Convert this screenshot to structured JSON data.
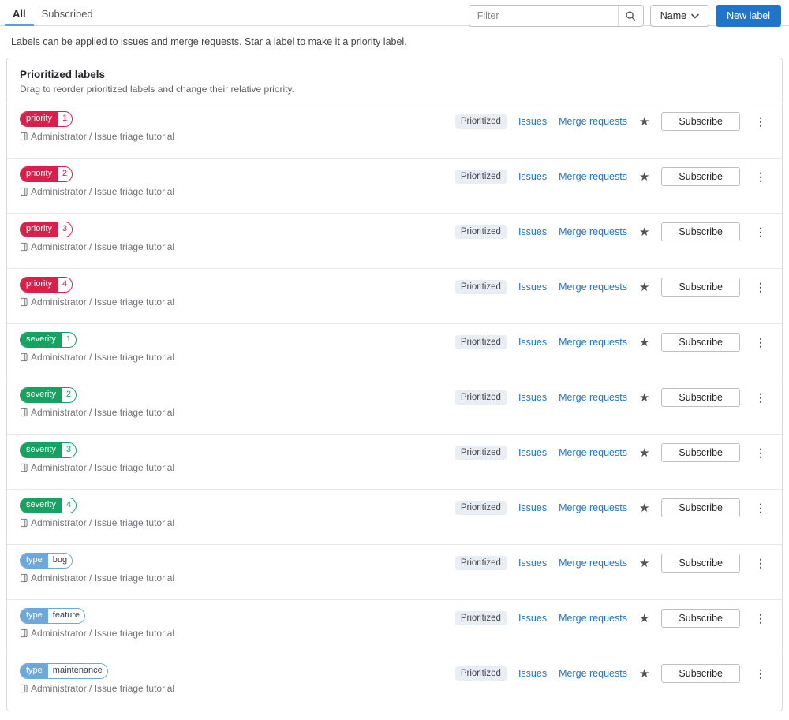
{
  "tabs": [
    {
      "label": "All",
      "active": true
    },
    {
      "label": "Subscribed",
      "active": false
    }
  ],
  "toolbar": {
    "filter_placeholder": "Filter",
    "sort_button_label": "Name",
    "new_label_button": "New label"
  },
  "description": "Labels can be applied to issues and merge requests. Star a label to make it a priority label.",
  "card": {
    "title": "Prioritized labels",
    "subtitle": "Drag to reorder prioritized labels and change their relative priority."
  },
  "row_actions": {
    "prioritized_badge": "Prioritized",
    "issues": "Issues",
    "merge_requests": "Merge requests",
    "subscribe": "Subscribe",
    "star_icon": "★",
    "kebab_icon": "⋮"
  },
  "colors": {
    "accent_blue": "#1f75cb",
    "tab_underline": "#5e9ce0",
    "priority_red": "#dc1e4a",
    "severity_green": "#16a362",
    "type_blue": "#6ba9dd",
    "type_value_text": "#3a3a3f",
    "prioritized_badge_bg": "#e9eef5",
    "card_border": "#dbdbdf"
  },
  "labels": [
    {
      "scope": "priority",
      "value": "1",
      "color": "#dc1e4a",
      "value_color": "#dc1e4a",
      "project": "Administrator / Issue triage tutorial"
    },
    {
      "scope": "priority",
      "value": "2",
      "color": "#dc1e4a",
      "value_color": "#dc1e4a",
      "project": "Administrator / Issue triage tutorial"
    },
    {
      "scope": "priority",
      "value": "3",
      "color": "#dc1e4a",
      "value_color": "#dc1e4a",
      "project": "Administrator / Issue triage tutorial"
    },
    {
      "scope": "priority",
      "value": "4",
      "color": "#dc1e4a",
      "value_color": "#dc1e4a",
      "project": "Administrator / Issue triage tutorial"
    },
    {
      "scope": "severity",
      "value": "1",
      "color": "#16a362",
      "value_color": "#16a362",
      "project": "Administrator / Issue triage tutorial"
    },
    {
      "scope": "severity",
      "value": "2",
      "color": "#16a362",
      "value_color": "#16a362",
      "project": "Administrator / Issue triage tutorial"
    },
    {
      "scope": "severity",
      "value": "3",
      "color": "#16a362",
      "value_color": "#16a362",
      "project": "Administrator / Issue triage tutorial"
    },
    {
      "scope": "severity",
      "value": "4",
      "color": "#16a362",
      "value_color": "#16a362",
      "project": "Administrator / Issue triage tutorial"
    },
    {
      "scope": "type",
      "value": "bug",
      "color": "#6ba9dd",
      "value_color": "#3a3a3f",
      "project": "Administrator / Issue triage tutorial"
    },
    {
      "scope": "type",
      "value": "feature",
      "color": "#6ba9dd",
      "value_color": "#3a3a3f",
      "project": "Administrator / Issue triage tutorial"
    },
    {
      "scope": "type",
      "value": "maintenance",
      "color": "#6ba9dd",
      "value_color": "#3a3a3f",
      "project": "Administrator / Issue triage tutorial"
    }
  ]
}
